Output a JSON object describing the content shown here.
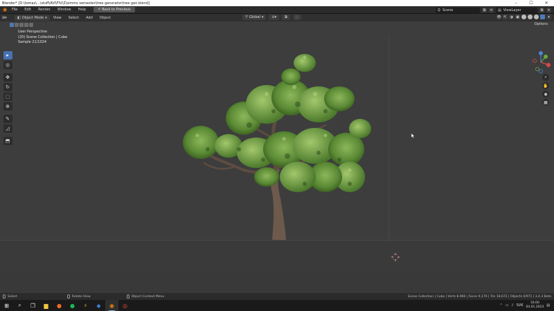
{
  "window": {
    "title": "Blender* [D:\\tomas\\...\\stuff\\AVI\\FIV\\Z\\simms semester\\tree generator\\tree gen.blend]",
    "controls": [
      "–",
      "☐",
      "✕"
    ]
  },
  "menubar": {
    "items": [
      "File",
      "Edit",
      "Render",
      "Window",
      "Help"
    ],
    "back_button": "Back to Previous",
    "scene_label": "Scene",
    "view_layer_label": "ViewLayer"
  },
  "viewport_header": {
    "mode": "Object Mode",
    "menus": [
      "View",
      "Select",
      "Add",
      "Object"
    ],
    "transform_orientation": "Global",
    "options_label": "Options"
  },
  "viewport_overlay": {
    "line1": "User Perspective",
    "line2": "(20) Scene Collection | Cube",
    "line3": "Sample 21/1024"
  },
  "statusbar": {
    "left": "Select",
    "middle": "Rotate View",
    "right": "Object Context Menu",
    "stats": "Scene Collection | Cube | Verts 8,966 | Faces 9,179 | Tris 18,672 | Objects 0/971 | 3.4.3 Beta"
  },
  "taskbar": {
    "language": "SVK",
    "time": "16:00",
    "date": "04.01.2023"
  },
  "colors": {
    "viewport_bg": "#3d3d3d",
    "active_tool": "#4772b3",
    "foliage": "#5f8f3a",
    "trunk": "#6d5a4c"
  }
}
